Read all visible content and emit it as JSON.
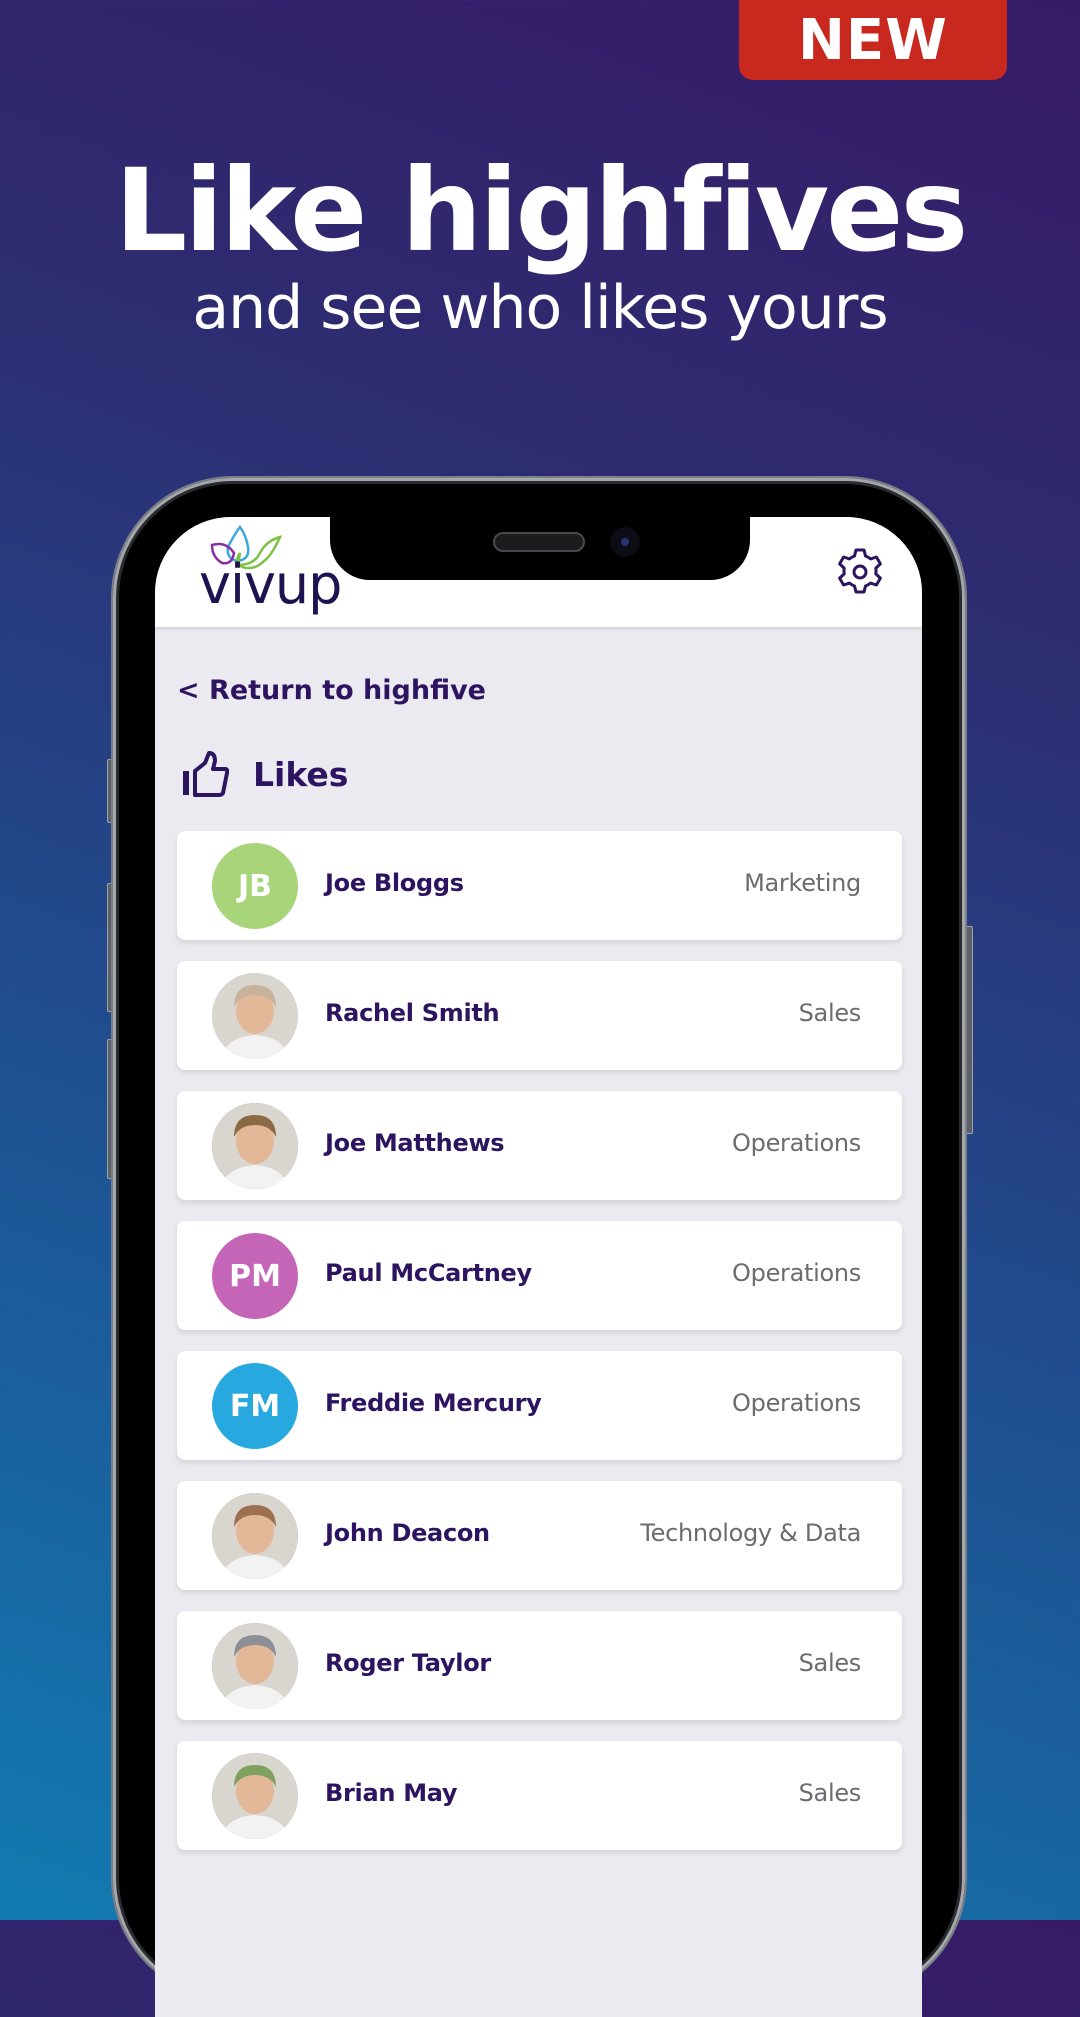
{
  "promo": {
    "badge": "NEW",
    "headline": "Like highfives",
    "subheadline": "and see who likes yours",
    "badge_color": "#c8281e"
  },
  "app": {
    "brand": "vivup",
    "logo_icon": "vivup-leaves-logo",
    "settings_icon": "gear-icon",
    "back_link": "< Return to highfive",
    "section_icon": "thumbs-up-icon",
    "section_title": "Likes",
    "text_color": "#2d1460"
  },
  "likes": [
    {
      "name": "Joe Bloggs",
      "department": "Marketing",
      "initials": "JB",
      "avatar_type": "initials",
      "avatar_color": "#a8d47a"
    },
    {
      "name": "Rachel Smith",
      "department": "Sales",
      "initials": "",
      "avatar_type": "photo",
      "avatar_color": "#c7b29c"
    },
    {
      "name": "Joe Matthews",
      "department": "Operations",
      "initials": "",
      "avatar_type": "photo",
      "avatar_color": "#8a6a45"
    },
    {
      "name": "Paul McCartney",
      "department": "Operations",
      "initials": "PM",
      "avatar_type": "initials",
      "avatar_color": "#c565b8"
    },
    {
      "name": "Freddie Mercury",
      "department": "Operations",
      "initials": "FM",
      "avatar_type": "initials",
      "avatar_color": "#27a9df"
    },
    {
      "name": "John Deacon",
      "department": "Technology & Data",
      "initials": "",
      "avatar_type": "photo",
      "avatar_color": "#9c6f4f"
    },
    {
      "name": "Roger Taylor",
      "department": "Sales",
      "initials": "",
      "avatar_type": "photo",
      "avatar_color": "#8c8f96"
    },
    {
      "name": "Brian May",
      "department": "Sales",
      "initials": "",
      "avatar_type": "photo",
      "avatar_color": "#7fa05e"
    }
  ]
}
